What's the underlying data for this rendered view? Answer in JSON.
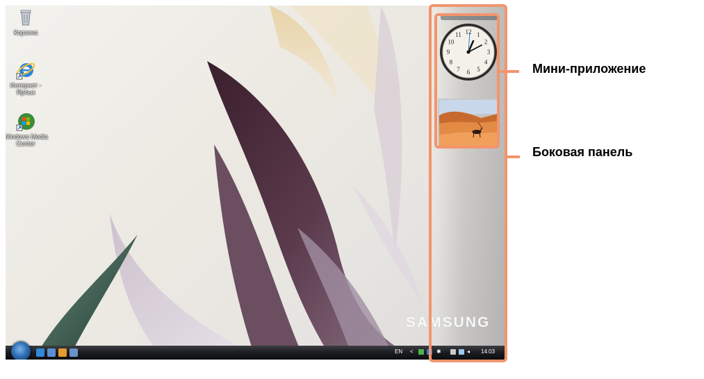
{
  "desktop_icons": [
    {
      "label": "Корзина",
      "icon": "recycle-bin-icon"
    },
    {
      "label": "Интернет - Ярлык",
      "icon": "internet-explorer-icon"
    },
    {
      "label": "Windows Media Center",
      "icon": "windows-media-center-icon"
    }
  ],
  "sidebar": {
    "brand": "SAMSUNG",
    "clock": {
      "numerals": [
        "12",
        "1",
        "2",
        "3",
        "4",
        "5",
        "6",
        "7",
        "8",
        "9",
        "10",
        "11"
      ]
    }
  },
  "taskbar": {
    "language": "EN",
    "time": "14:03"
  },
  "callouts": {
    "gadget": "Мини-приложение",
    "sidebar": "Боковая панель"
  },
  "colors": {
    "highlight": "#f2956e",
    "taskbar": "#1a1c20"
  }
}
